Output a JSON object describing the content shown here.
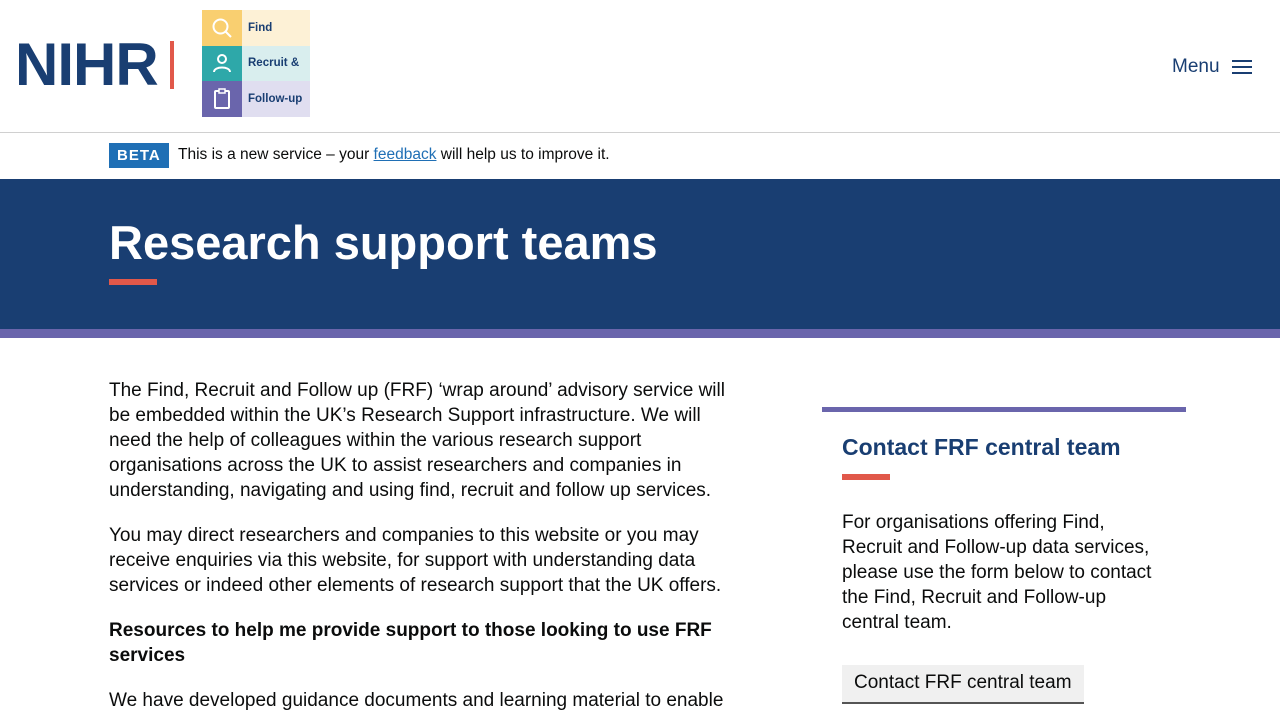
{
  "header": {
    "nihr_text": "NIHR",
    "frf_logo": {
      "rows": [
        {
          "label": "Find",
          "icon": "search-icon"
        },
        {
          "label": "Recruit &",
          "icon": "person-icon"
        },
        {
          "label": "Follow-up",
          "icon": "clipboard-icon"
        }
      ]
    },
    "menu_label": "Menu"
  },
  "beta_banner": {
    "tag": "BETA",
    "text_before": "This is a new service – your ",
    "link": "feedback",
    "text_after": " will help us to improve it."
  },
  "hero": {
    "title": "Research support teams"
  },
  "main": {
    "paragraphs": [
      "The Find, Recruit and Follow up (FRF) ‘wrap around’ advisory service will be embedded within the UK’s Research Support infrastructure. We will need the help of colleagues within the various research support organisations across the UK to assist researchers and companies in understanding, navigating and using find, recruit and follow up services.",
      "You may direct researchers and companies to this website or you may receive enquiries via this website, for support with understanding data services or indeed other elements of research support that the UK offers."
    ],
    "subheading": "Resources to help me provide support to those looking to use FRF services",
    "paragraph_3": "We have developed guidance documents and learning material to enable"
  },
  "sidebar": {
    "title": "Contact FRF central team",
    "text": "For organisations offering Find, Recruit and Follow-up data services, please use the form below to contact the Find, Recruit and Follow-up central team.",
    "button_label": "Contact FRF central team"
  },
  "colors": {
    "navy": "#193e72",
    "accent_red": "#e1584a",
    "purple": "#6a65ac",
    "link_blue": "#1f6fb5"
  }
}
